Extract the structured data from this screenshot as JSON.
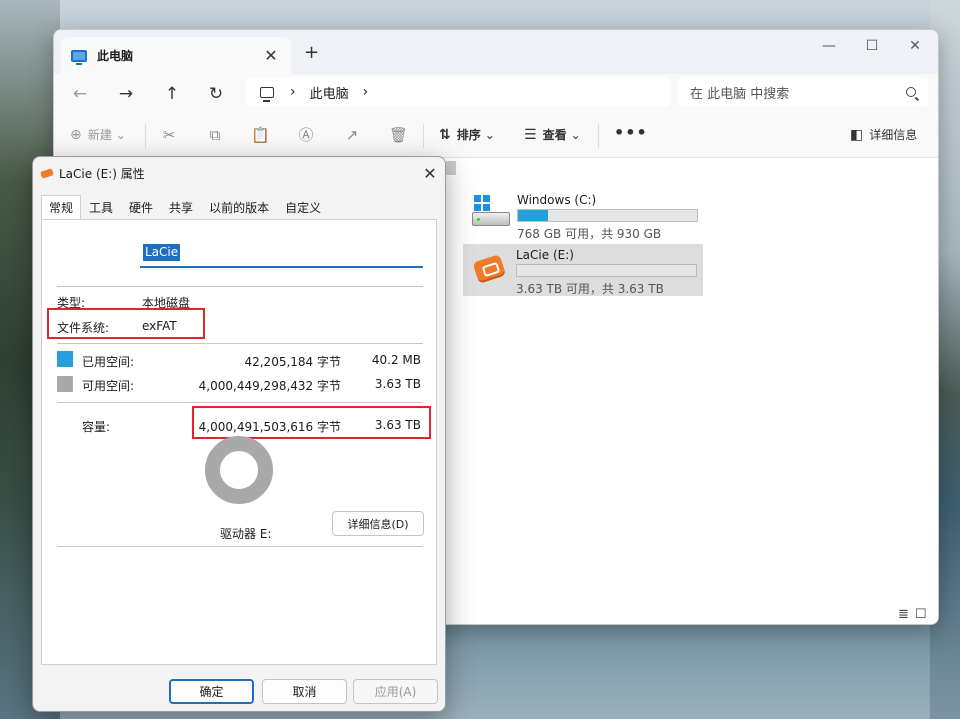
{
  "explorer": {
    "tab_title": "此电脑",
    "tab_close": "✕",
    "new_tab": "+",
    "window_controls": {
      "minimize": "—",
      "maximize": "☐",
      "close": "✕"
    },
    "nav": {
      "back": "←",
      "forward": "→",
      "up": "↑",
      "refresh": "↻"
    },
    "breadcrumb": {
      "sep1": "›",
      "item": "此电脑",
      "sep2": "›"
    },
    "search_placeholder": "在 此电脑 中搜索",
    "toolbar": {
      "new_label": "新建",
      "new_chevron": "⌄",
      "icons": {
        "cut": "✂",
        "copy": "⧉",
        "paste": "📋",
        "rename": "Ⓐ",
        "share": "↗",
        "delete": "🗑"
      },
      "sort_symbol": "⇅",
      "sort_label": "排序",
      "sort_chevron": "⌄",
      "view_symbol": "☰",
      "view_label": "查看",
      "view_chevron": "⌄",
      "more_label": "•••",
      "details_symbol": "◧",
      "details_label": "详细信息"
    },
    "drives": [
      {
        "name": "Windows (C:)",
        "free_text": "768 GB 可用，共 930 GB",
        "used_fraction": 0.17
      },
      {
        "name": "LaCie (E:)",
        "free_text": "3.63 TB 可用，共 3.63 TB",
        "used_fraction": 0.0
      }
    ],
    "view_icons": "≣☐"
  },
  "dialog": {
    "title": "LaCie (E:) 属性",
    "close": "✕",
    "tabs": [
      "常规",
      "工具",
      "硬件",
      "共享",
      "以前的版本",
      "自定义"
    ],
    "name_value": "LaCie",
    "type_label": "类型:",
    "type_value": "本地磁盘",
    "fs_label": "文件系统:",
    "fs_value": "exFAT",
    "used": {
      "label": "已用空间:",
      "bytes": "42,205,184 字节",
      "size": "40.2 MB",
      "color": "#26a0da"
    },
    "free": {
      "label": "可用空间:",
      "bytes": "4,000,449,298,432 字节",
      "size": "3.63 TB",
      "color": "#a9a9a9"
    },
    "capacity": {
      "label": "容量:",
      "bytes": "4,000,491,503,616 字节",
      "size": "3.63 TB"
    },
    "drive_label": "驱动器 E:",
    "details_button": "详细信息(D)",
    "ok_button": "确定",
    "cancel_button": "取消",
    "apply_button": "应用(A)"
  },
  "colors": {
    "accent": "#1f6fbf",
    "highlight": "#e0252a",
    "used": "#26a0da",
    "free": "#a9a9a9"
  }
}
